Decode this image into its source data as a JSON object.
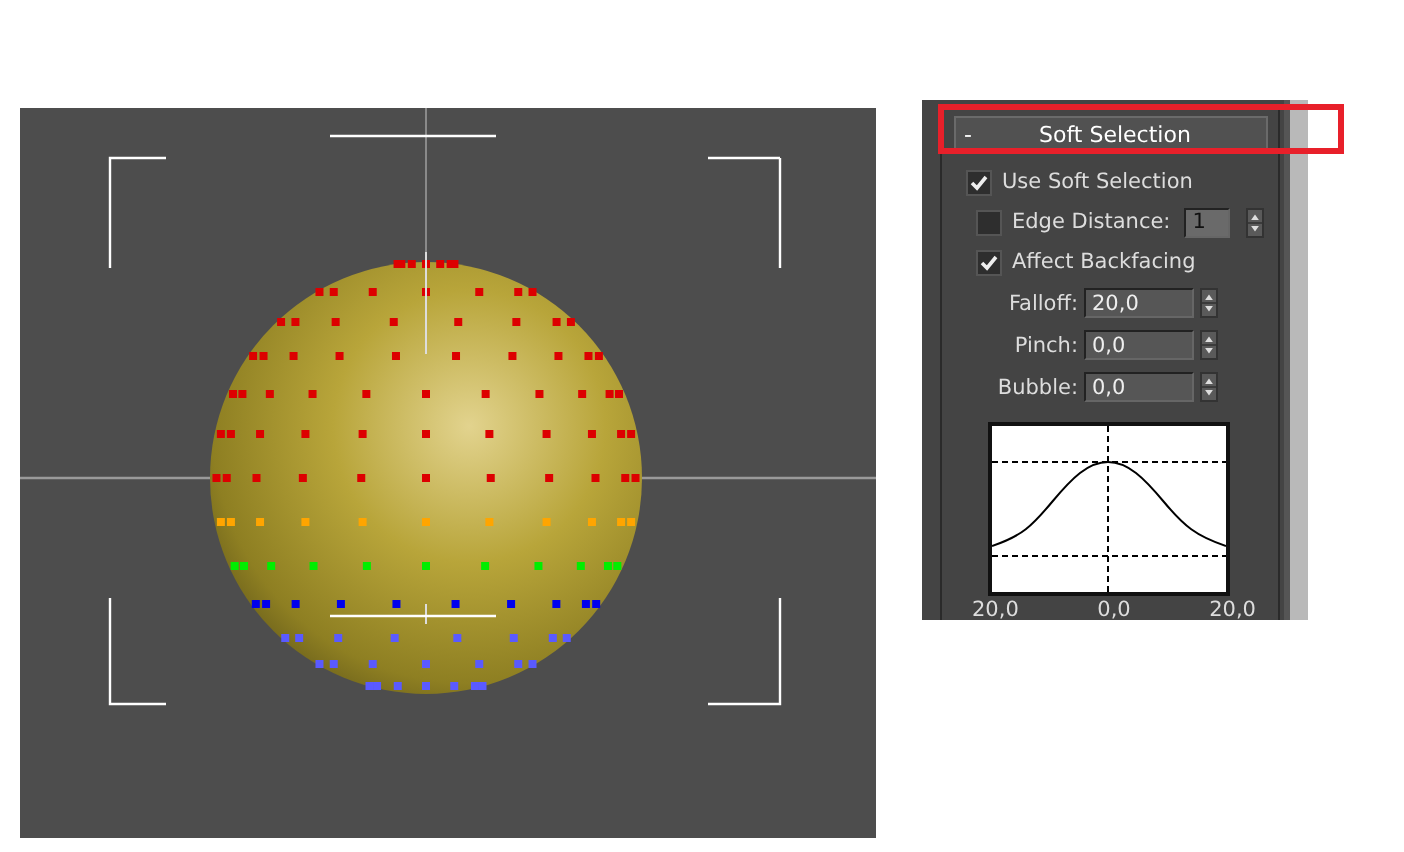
{
  "rollout": {
    "collapse_sign": "-",
    "title": "Soft Selection",
    "highlighted": true
  },
  "options": [
    {
      "kind": "checkbox",
      "label": "Use Soft Selection",
      "checked": true
    },
    {
      "kind": "checkbox-spinner",
      "label": "Edge Distance:",
      "checked": false,
      "value": "1",
      "disabled": true
    },
    {
      "kind": "checkbox",
      "label": "Affect Backfacing",
      "checked": true
    }
  ],
  "spinners": [
    {
      "label": "Falloff:",
      "value": "20,0"
    },
    {
      "label": "Pinch:",
      "value": "0,0"
    },
    {
      "label": "Bubble:",
      "value": "0,0"
    }
  ],
  "curve": {
    "axis_labels": [
      "20,0",
      "0,0",
      "20,0"
    ]
  }
}
